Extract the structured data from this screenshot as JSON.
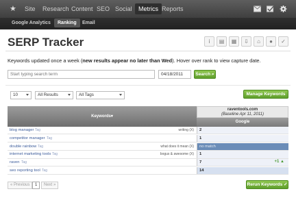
{
  "topnav": {
    "home_icon": "star-icon",
    "items": [
      "Site",
      "Research",
      "Content",
      "SEO",
      "Social",
      "Metrics",
      "Reports"
    ],
    "active": "Metrics",
    "right_icons": [
      "mail-icon",
      "checkbox-icon",
      "gear-icon"
    ]
  },
  "subnav": {
    "tabs": [
      "Google Analytics",
      "Ranking",
      "Email"
    ],
    "active": "Ranking"
  },
  "page": {
    "title": "SERP Tracker",
    "tool_icons": [
      "info-icon",
      "pdf-icon",
      "calendar-icon",
      "download-icon",
      "inbox-icon",
      "comment-icon",
      "check-circle-icon"
    ],
    "desc_pre": "Keywords updated once a week (",
    "desc_bold": "new results appear no later than Wed",
    "desc_post": "). Hover over rank to view capture date."
  },
  "search": {
    "placeholder": "Start typing search term",
    "date": "04/18/2011",
    "button": "Search"
  },
  "filters": {
    "count": "10",
    "results": "All Results",
    "tags": "All Tags",
    "manage_button": "Manage Keywords"
  },
  "table": {
    "kw_header": "Keywords",
    "site": "raventools.com",
    "baseline": "(Baseline Apr 11, 2011)",
    "engine": "Google",
    "rows": [
      {
        "kw": "blog manager",
        "tag": "Tag",
        "note": "writing (X)",
        "rank": "2",
        "change": ""
      },
      {
        "kw": "competitor manager",
        "tag": "Tag",
        "note": "",
        "rank": "1",
        "change": ""
      },
      {
        "kw": "double rainbow",
        "tag": "Tag",
        "note": "what does it mean (X)",
        "rank": "no match",
        "change": ""
      },
      {
        "kw": "internet marketing tools",
        "tag": "Tag",
        "note": "bogus & awesome (X)",
        "rank": "1",
        "change": ""
      },
      {
        "kw": "raven",
        "tag": "Tag",
        "note": "",
        "rank": "7",
        "change": "+1 ▲"
      },
      {
        "kw": "seo reporting tool",
        "tag": "Tag",
        "note": "",
        "rank": "14",
        "change": ""
      }
    ]
  },
  "pagination": {
    "prev": "« Previous",
    "current": "1",
    "next": "Next »"
  },
  "rerun_button": "Rerun Keywords"
}
